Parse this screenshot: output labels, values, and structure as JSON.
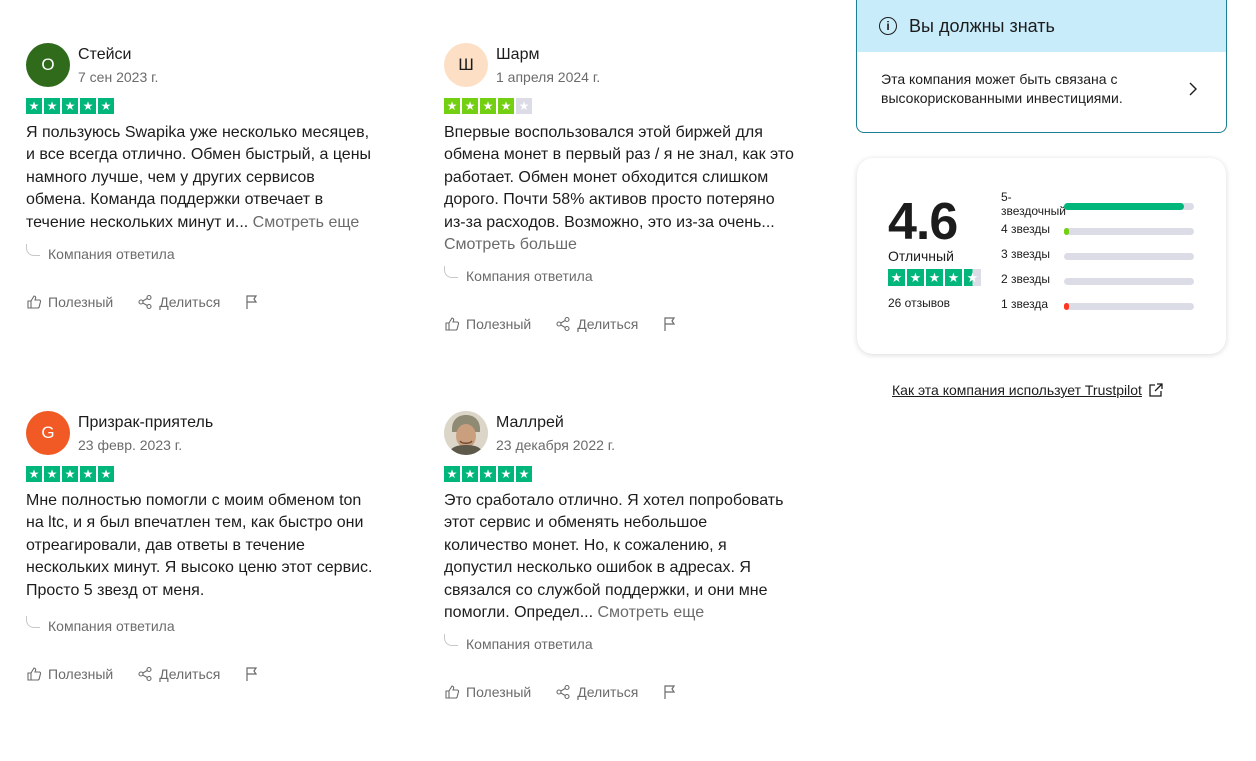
{
  "colors": {
    "star_green": "#00b67a",
    "star_lightgreen": "#73cf11",
    "star_empty": "#dcdce6",
    "bar_green": "#00b67a",
    "bar_lightgreen": "#73cf11",
    "bar_red": "#ff3722",
    "notice_bg": "#c9ecfb",
    "notice_border": "#1b7f95"
  },
  "reviews": [
    {
      "avatar_letter": "О",
      "avatar_color": "#2f6b1b",
      "avatar_text_color": "#ffffff",
      "name": "Стейси",
      "date": "7 сен 2023 г.",
      "rating": 5,
      "text": "Я пользуюсь Swapika уже несколько месяцев, и все всегда отлично. Обмен быстрый, а цены намного лучше, чем у других сервисов обмена. Команда поддержки отвечает в течение нескольких минут и...",
      "more": "Смотреть еще",
      "reply": "Компания ответила",
      "helpful": "Полезный",
      "share": "Делиться"
    },
    {
      "avatar_letter": "Ш",
      "avatar_color": "#fcdfc5",
      "avatar_text_color": "#1c1c1c",
      "name": "Шарм",
      "date": "1 апреля 2024 г.",
      "rating": 4,
      "text": "Впервые воспользовался этой биржей для обмена монет в первый раз / я не знал, как это работает. Обмен монет обходится слишком дорого. Почти 58% активов просто потеряно из-за расходов. Возможно, это из-за очень...",
      "more": "Смотреть больше",
      "reply": "Компания ответила",
      "helpful": "Полезный",
      "share": "Делиться"
    },
    {
      "avatar_letter": "G",
      "avatar_color": "#f15a24",
      "avatar_text_color": "#ffffff",
      "name": "Призрак-приятель",
      "date": "23 февр. 2023 г.",
      "rating": 5,
      "text": "Мне полностью помогли с моим обменом ton на ltc, и я был впечатлен тем, как быстро они отреагировали, дав ответы в течение нескольких минут. Я высоко ценю этот сервис. Просто 5 звезд от меня.",
      "more": "",
      "reply": "Компания ответила",
      "helpful": "Полезный",
      "share": "Делиться"
    },
    {
      "avatar_letter": "",
      "avatar_color": "#b9b2a3",
      "avatar_text_color": "#ffffff",
      "name": "Маллрей",
      "date": "23 декабря 2022 г.",
      "rating": 5,
      "text": "Это сработало отлично. Я хотел попробовать этот сервис и обменять небольшое количество монет. Но, к сожалению, я допустил несколько ошибок в адресах. Я связался со службой поддержки, и они мне помогли. Определ...",
      "more": "Смотреть еще",
      "reply": "Компания ответила",
      "helpful": "Полезный",
      "share": "Делиться"
    }
  ],
  "notice": {
    "title": "Вы должны знать",
    "text": "Эта компания может быть связана с высокорискованными инвестициями."
  },
  "summary": {
    "score": "4.6",
    "verdict": "Отличный",
    "rating_stars": 4.5,
    "count": "26 отзывов",
    "bars": [
      {
        "label": "5-звездочный",
        "fraction": 0.92,
        "color": "#00b67a"
      },
      {
        "label": "4 звезды",
        "fraction": 0.04,
        "color": "#73cf11"
      },
      {
        "label": "3 звезды",
        "fraction": 0.0,
        "color": "#dcdce6"
      },
      {
        "label": "2 звезды",
        "fraction": 0.0,
        "color": "#dcdce6"
      },
      {
        "label": "1 звезда",
        "fraction": 0.04,
        "color": "#ff3722"
      }
    ]
  },
  "link": "Как эта компания использует Trustpilot"
}
